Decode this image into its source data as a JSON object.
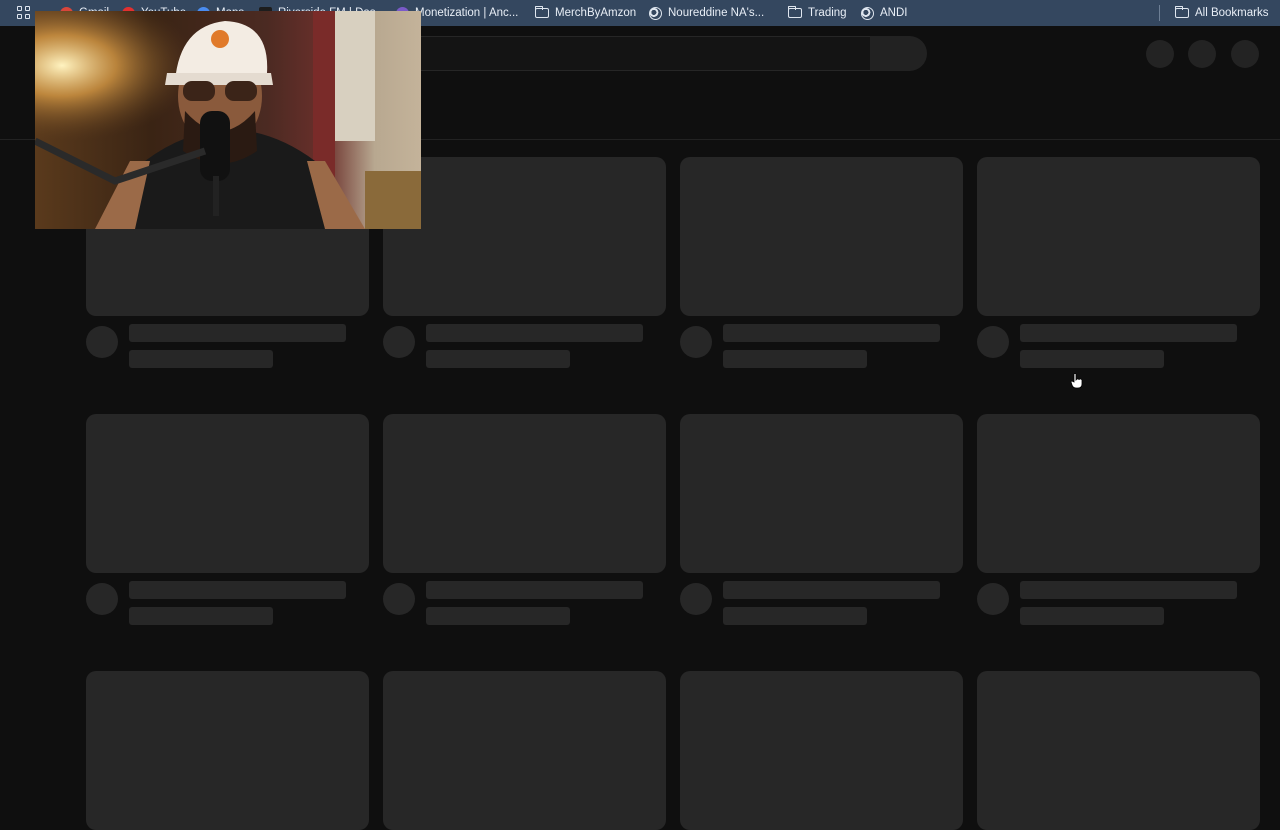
{
  "bookmarks": [
    {
      "label": "Gmail",
      "icon": "gmail-icon"
    },
    {
      "label": "YouTube",
      "icon": "youtube-icon"
    },
    {
      "label": "Maps",
      "icon": "maps-icon"
    },
    {
      "label": "Riverside FM | Das...",
      "icon": "riverside-icon"
    },
    {
      "label": "Monetization | Anc...",
      "icon": "monetization-icon"
    },
    {
      "label": "MerchByAmzon",
      "icon": "folder-icon"
    },
    {
      "label": "Noureddine NA's...",
      "icon": "globe-icon"
    },
    {
      "label": "Trading",
      "icon": "folder-icon"
    },
    {
      "label": "ANDI",
      "icon": "globe-icon"
    },
    {
      "label": "All Bookmarks",
      "icon": "folder-icon"
    }
  ],
  "colors": {
    "bookmarks_bar": "#34475f",
    "page_bg": "#0f0f0f",
    "skeleton": "#272727"
  }
}
